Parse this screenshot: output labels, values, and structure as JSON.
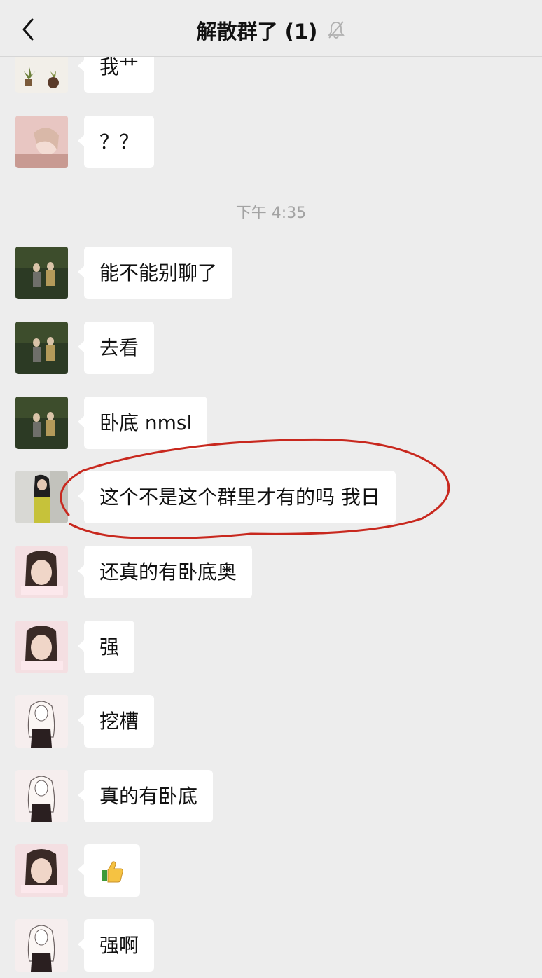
{
  "header": {
    "title": "解散群了 (1)",
    "icons": {
      "back": "chevron-left-icon",
      "mute": "bell-muted-icon"
    }
  },
  "timestamp": "下午 4:35",
  "messages": [
    {
      "text": "我艹",
      "avatar": "avatar-plants"
    },
    {
      "text": "？？",
      "avatar": "avatar-pink-girl"
    },
    {
      "text": "能不能别聊了",
      "avatar": "avatar-dark-couple"
    },
    {
      "text": "去看",
      "avatar": "avatar-dark-couple"
    },
    {
      "text": "卧底 nmsl",
      "avatar": "avatar-dark-couple"
    },
    {
      "text": "这个不是这个群里才有的吗  我日",
      "avatar": "avatar-girl-wall",
      "highlighted": true
    },
    {
      "text": "还真的有卧底奥",
      "avatar": "avatar-girl-face"
    },
    {
      "text": "强",
      "avatar": "avatar-girl-face"
    },
    {
      "text": "挖槽",
      "avatar": "avatar-sketch-girl"
    },
    {
      "text": "真的有卧底",
      "avatar": "avatar-sketch-girl"
    },
    {
      "text": "",
      "emoji": "thumbs-up-icon",
      "avatar": "avatar-girl-face"
    },
    {
      "text": "强啊",
      "avatar": "avatar-sketch-girl"
    }
  ],
  "colors": {
    "background": "#ededed",
    "bubble": "#ffffff",
    "annotation": "#c8281e",
    "timestamp": "#a3a3a3"
  }
}
